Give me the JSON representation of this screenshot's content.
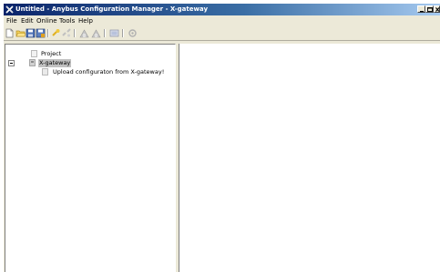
{
  "window": {
    "title": "Untitled - Anybus Configuration Manager - X-gateway",
    "app_icon": "anybus-app-icon",
    "controls": [
      "minimize-icon",
      "maximize-icon",
      "close-icon"
    ]
  },
  "menubar": {
    "items": [
      {
        "label": "File"
      },
      {
        "label": "Edit"
      },
      {
        "label": "Online"
      },
      {
        "label": "Tools"
      },
      {
        "label": "Help"
      }
    ]
  },
  "toolbar": {
    "buttons": [
      {
        "icon": "new-file-icon"
      },
      {
        "icon": "open-folder-icon"
      },
      {
        "icon": "save-icon"
      },
      {
        "icon": "save-as-icon"
      },
      {
        "icon": "connect-icon"
      },
      {
        "icon": "disconnect-icon"
      },
      {
        "icon": "upload-icon"
      },
      {
        "icon": "download-icon"
      },
      {
        "icon": "monitor-icon"
      },
      {
        "icon": "options-icon"
      }
    ]
  },
  "tree": {
    "items": [
      {
        "label": "Project",
        "icon": "project-icon"
      },
      {
        "label": "X-gateway",
        "icon": "gateway-icon",
        "expanded": true,
        "selected": true
      },
      {
        "label": "Upload configuraton from X-gateway!",
        "icon": "upload-config-icon"
      }
    ]
  },
  "colors": {
    "title_bar_start": "#0a246a",
    "title_bar_end": "#a6caf0",
    "window_face": "#ece9d8",
    "selection": "#c0c0c0"
  }
}
